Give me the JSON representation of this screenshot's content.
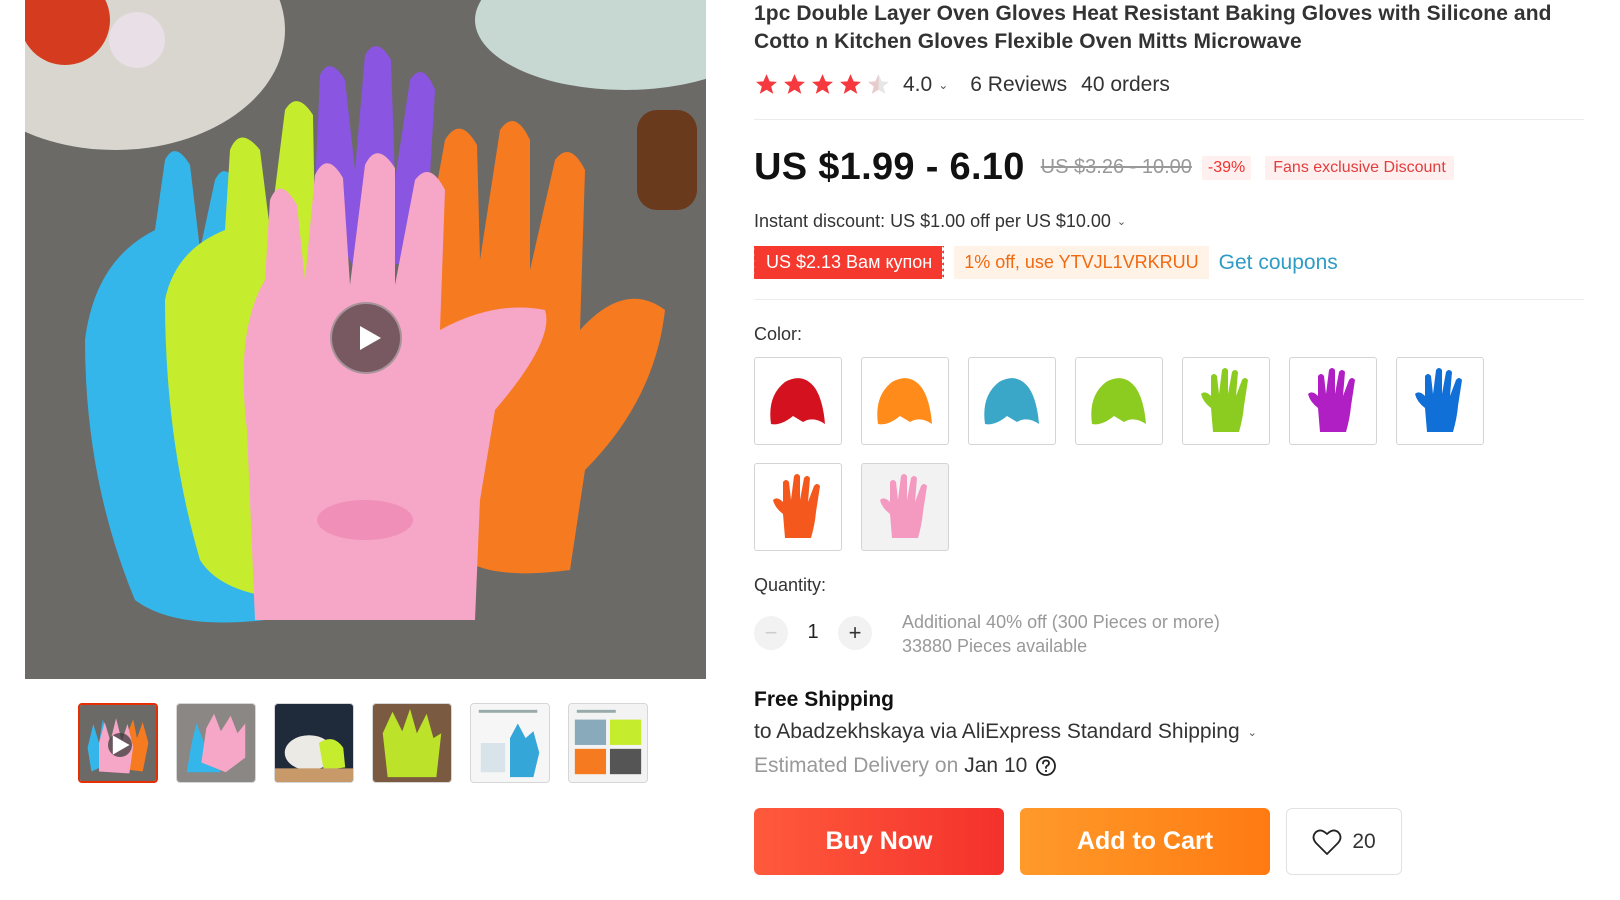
{
  "product": {
    "title": "1pc Double Layer Oven Gloves Heat Resistant Baking Gloves with Silicone and Cotto n Kitchen Gloves Flexible Oven Mitts Microwave",
    "rating": "4.0",
    "rating_value": 4.0,
    "reviews": "6 Reviews",
    "orders": "40 orders"
  },
  "price": {
    "current": "US $1.99 - 6.10",
    "original": "US $3.26 - 10.00",
    "discount": "-39%",
    "fans_tag": "Fans exclusive Discount",
    "instant_discount": "Instant discount: US $1.00 off per US $10.00"
  },
  "coupons": {
    "coupon_label": "US $2.13 Вам купон",
    "code_label": "1% off, use YTVJL1VRKRUU",
    "get_coupons": "Get coupons"
  },
  "color": {
    "label": "Color:",
    "options": [
      {
        "name": "red-mitt-swatch",
        "color": "#d4121f",
        "shape": "mitt"
      },
      {
        "name": "orange-mitt-swatch",
        "color": "#ff8c1a",
        "shape": "mitt"
      },
      {
        "name": "blue-mitt-swatch",
        "color": "#3aa7c9",
        "shape": "mitt"
      },
      {
        "name": "green-mitt-swatch",
        "color": "#8ccc20",
        "shape": "mitt"
      },
      {
        "name": "green-glove-swatch",
        "color": "#8ccc20",
        "shape": "glove"
      },
      {
        "name": "purple-glove-swatch",
        "color": "#b01fc4",
        "shape": "glove"
      },
      {
        "name": "blue-glove-swatch",
        "color": "#1170d8",
        "shape": "glove"
      },
      {
        "name": "orange-glove-swatch",
        "color": "#f4581c",
        "shape": "glove"
      },
      {
        "name": "pink-glove-swatch",
        "color": "#f49ac0",
        "shape": "glove"
      }
    ]
  },
  "quantity": {
    "label": "Quantity:",
    "value": "1",
    "decrement": "−",
    "increment": "+",
    "bulk_note": "Additional 40% off (300 Pieces or more)",
    "available": "33880 Pieces available"
  },
  "shipping": {
    "title": "Free Shipping",
    "route": "to Abadzekhskaya via AliExpress Standard Shipping",
    "estimated_label": "Estimated Delivery on",
    "date": "Jan 10"
  },
  "actions": {
    "buy_now": "Buy Now",
    "add_to_cart": "Add to Cart",
    "wishlist_count": "20"
  },
  "gallery": {
    "thumbnail_count": 6
  }
}
